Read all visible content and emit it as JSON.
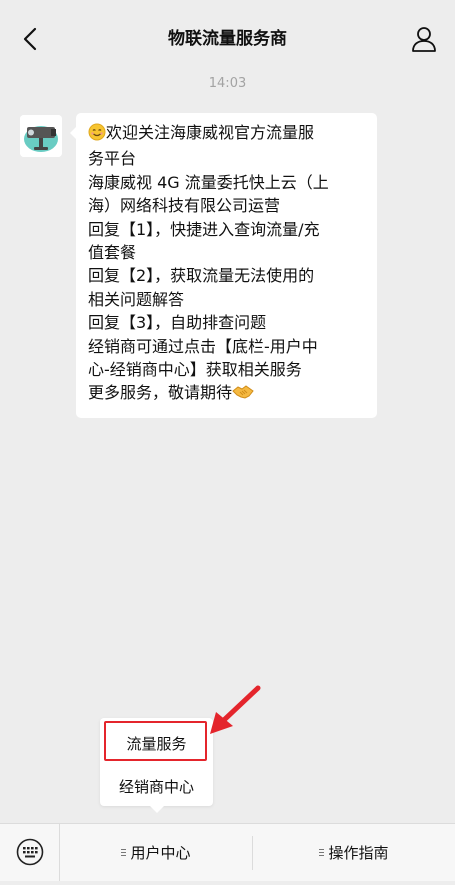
{
  "header": {
    "title": "物联流量服务商"
  },
  "icons": {
    "back": "chevron-left-icon",
    "profile": "person-icon",
    "keyboard": "keyboard-icon",
    "avatar": "camera-avatar"
  },
  "chat": {
    "timestamp": "14:03",
    "message_lines": [
      "欢迎关注海康威视官方流量服",
      "务平台",
      "海康威视 4G 流量委托快上云（上",
      "海）网络科技有限公司运营",
      "回复【1】，快捷进入查询流量/充",
      "值套餐",
      "回复【2】，获取流量无法使用的",
      "相关问题解答",
      "回复【3】，自助排查问题",
      "经销商可通过点击【底栏-用户中",
      "心-经销商中心】获取相关服务",
      "更多服务，敬请期待"
    ]
  },
  "popup_menu": {
    "items": [
      "流量服务",
      "经销商中心"
    ]
  },
  "bottom_menu": {
    "items": [
      "用户中心",
      "操作指南"
    ]
  },
  "colors": {
    "background": "#ededed",
    "bubble": "#ffffff",
    "highlight": "#e4252c",
    "bottombar": "#f7f7f7"
  }
}
